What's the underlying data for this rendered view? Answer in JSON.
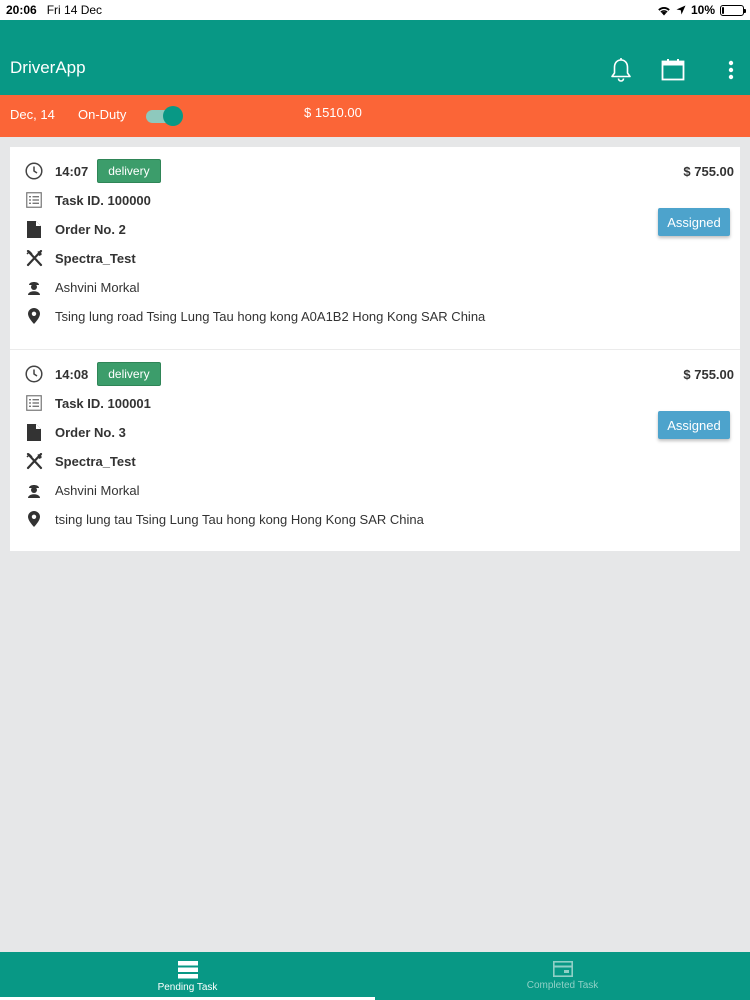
{
  "status_bar": {
    "time": "20:06",
    "date": "Fri 14 Dec",
    "battery": "10%",
    "battery_level": 0.1
  },
  "app_bar": {
    "title": "DriverApp",
    "icons": [
      "bell-icon",
      "calendar-icon",
      "more-vert-icon"
    ]
  },
  "duty_bar": {
    "date": "Dec, 14",
    "duty_label": "On-Duty",
    "duty_on": true,
    "total_amount": "$ 1510.00"
  },
  "tasks": [
    {
      "time": "14:07",
      "type": "delivery",
      "amount": "$ 755.00",
      "task_id": "Task ID. 100000",
      "order_no": "Order No. 2",
      "restaurant": "Spectra_Test",
      "customer": "Ashvini Morkal",
      "address": "Tsing lung road Tsing Lung Tau hong kong A0A1B2 Hong Kong SAR China",
      "status": "Assigned"
    },
    {
      "time": "14:08",
      "type": "delivery",
      "amount": "$ 755.00",
      "task_id": "Task ID. 100001",
      "order_no": "Order No. 3",
      "restaurant": "Spectra_Test",
      "customer": "Ashvini Morkal",
      "address": "tsing lung tau Tsing Lung Tau hong kong Hong Kong SAR China",
      "status": "Assigned"
    }
  ],
  "bottom_nav": {
    "pending_label": "Pending Task",
    "completed_label": "Completed Task",
    "active": "pending"
  },
  "colors": {
    "primary": "#089885",
    "duty_bar": "#fb6537",
    "badge": "#3c9d6b",
    "assigned_button": "#4da3cc",
    "background": "#e6e7e8"
  }
}
